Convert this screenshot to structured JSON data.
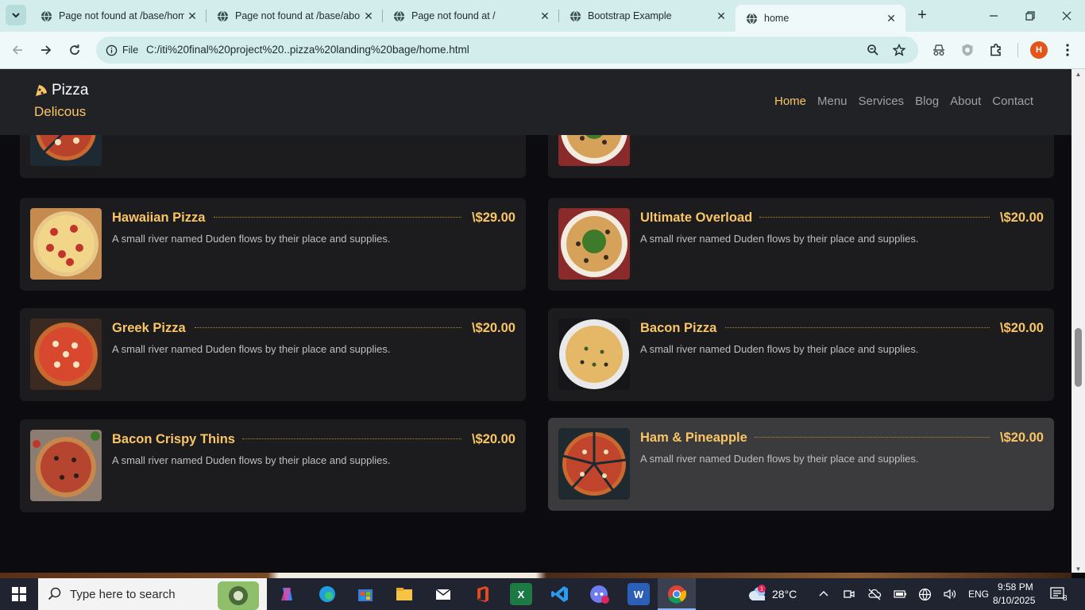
{
  "browser": {
    "tabs": [
      {
        "title": "Page not found at /base/home"
      },
      {
        "title": "Page not found at /base/about"
      },
      {
        "title": "Page not found at /"
      },
      {
        "title": "Bootstrap Example"
      },
      {
        "title": "home"
      }
    ],
    "address": {
      "scheme_label": "File",
      "url": "C:/iti%20final%20project%20..pizza%20landing%20bage/home.html"
    },
    "profile_initial": "H"
  },
  "site": {
    "brand": {
      "line1": "Pizza",
      "line2": "Delicous"
    },
    "nav": [
      "Home",
      "Menu",
      "Services",
      "Blog",
      "About",
      "Contact"
    ],
    "active_nav": "Home",
    "menu_items": [
      {
        "name": "Hawaiian Pizza",
        "price": "\\$29.00",
        "desc": "A small river named Duden flows by their place and supplies."
      },
      {
        "name": "Ultimate Overload",
        "price": "\\$20.00",
        "desc": "A small river named Duden flows by their place and supplies."
      },
      {
        "name": "Greek Pizza",
        "price": "\\$20.00",
        "desc": "A small river named Duden flows by their place and supplies."
      },
      {
        "name": "Bacon Pizza",
        "price": "\\$20.00",
        "desc": "A small river named Duden flows by their place and supplies."
      },
      {
        "name": "Bacon Crispy Thins",
        "price": "\\$20.00",
        "desc": "A small river named Duden flows by their place and supplies."
      },
      {
        "name": "Ham & Pineapple",
        "price": "\\$20.00",
        "desc": "A small river named Duden flows by their place and supplies."
      }
    ],
    "colors": {
      "accent": "#fac564",
      "card_bg": "#1c1c1e",
      "card_hover": "#3b3b3d",
      "nav_bg": "#212226"
    }
  },
  "taskbar": {
    "search_placeholder": "Type here to search",
    "weather": "28°C",
    "weather_badge": "1",
    "language": "ENG",
    "time": "9:58 PM",
    "date": "8/10/2025",
    "notifications": "8",
    "apps": [
      "copilot-icon",
      "edge-icon",
      "store-icon",
      "file-explorer-icon",
      "mail-icon",
      "office-icon",
      "excel-icon",
      "vscode-icon",
      "discord-icon",
      "word-icon",
      "chrome-icon"
    ]
  }
}
